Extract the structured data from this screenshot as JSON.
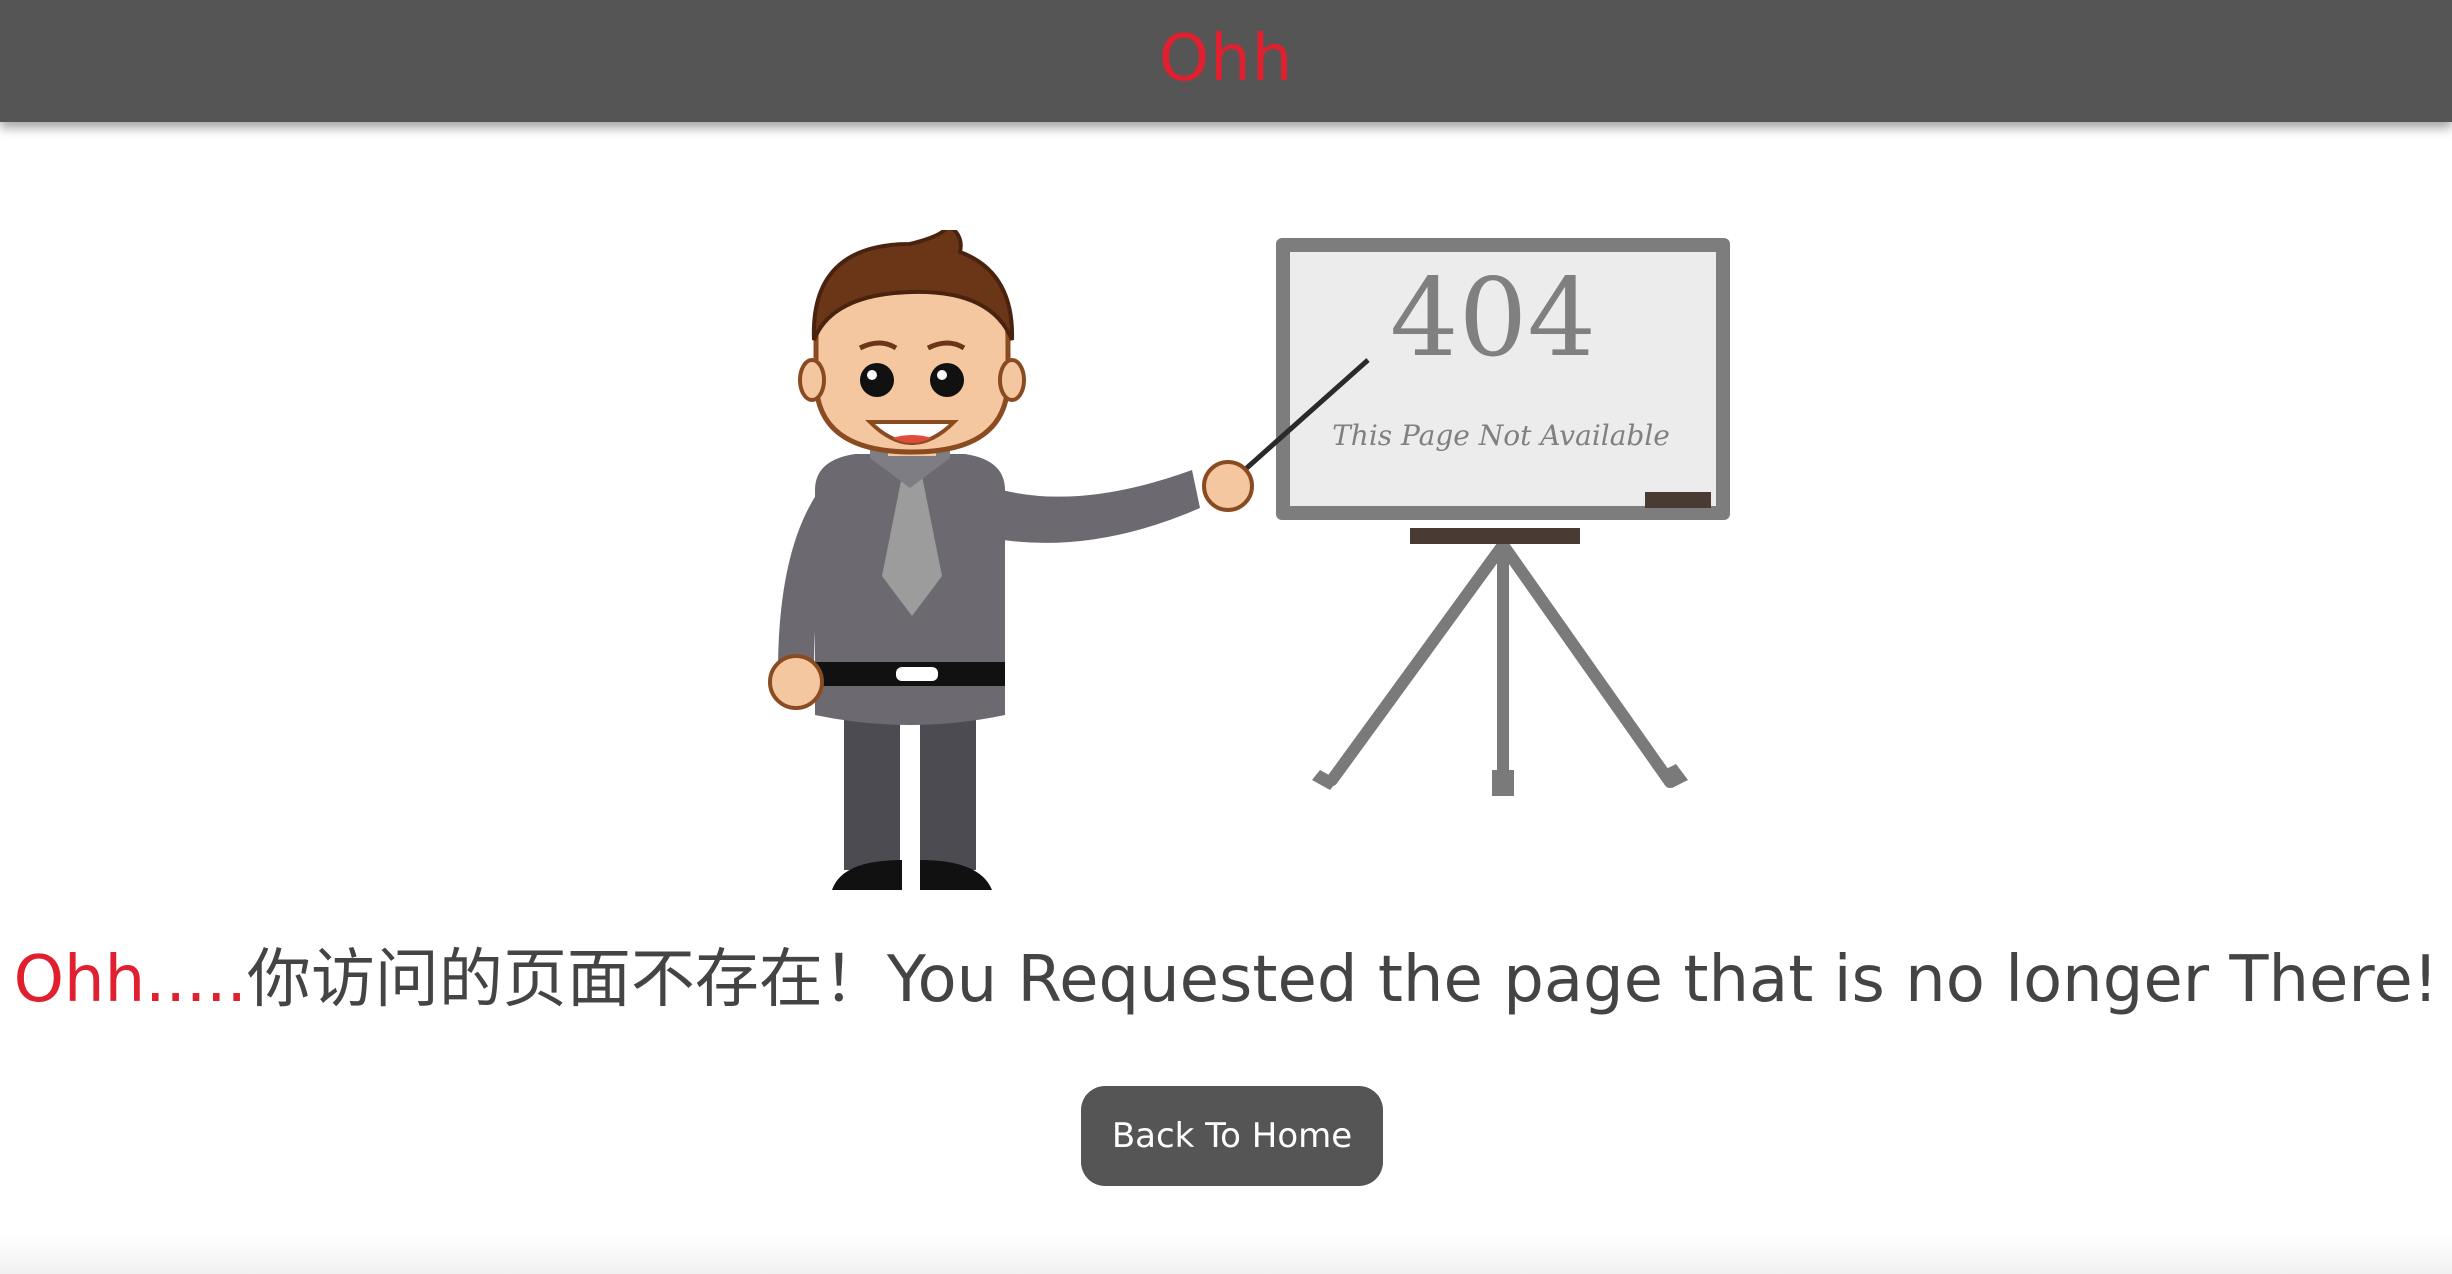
{
  "header": {
    "title": "Ohh"
  },
  "illustration": {
    "board_code": "404",
    "board_caption": "This Page Not Available"
  },
  "message": {
    "prefix": "Ohh.....",
    "chinese": "你访问的页面不存在！",
    "english": "You Requested the page that is no longer There!"
  },
  "actions": {
    "home_label": "Back To Home"
  },
  "colors": {
    "accent": "#e0202f",
    "header_bg": "#555555",
    "button_bg": "#555555",
    "text": "#444444"
  },
  "icons": [
    "presenter-illustration",
    "whiteboard-easel"
  ]
}
